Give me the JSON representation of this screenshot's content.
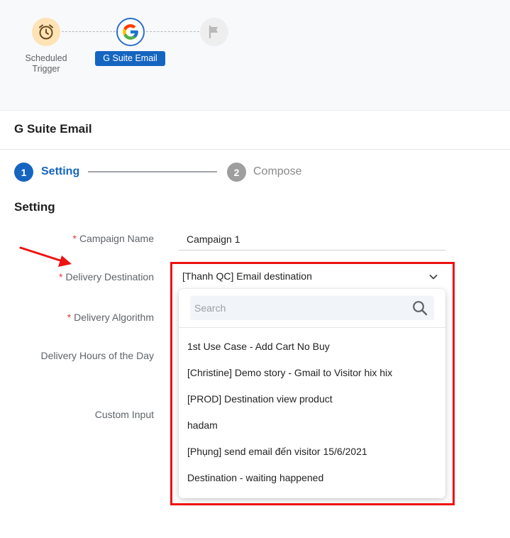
{
  "flow": {
    "nodes": [
      {
        "label": "Scheduled\nTrigger",
        "icon": "alarm-clock-icon"
      },
      {
        "label": "G Suite Email",
        "icon": "google-g-icon"
      },
      {
        "label": "",
        "icon": "flag-icon"
      }
    ]
  },
  "panel": {
    "title": "G Suite Email"
  },
  "stepper": {
    "steps": [
      {
        "number": "1",
        "label": "Setting"
      },
      {
        "number": "2",
        "label": "Compose"
      }
    ]
  },
  "section": {
    "title": "Setting"
  },
  "form": {
    "campaign_name": {
      "label": "Campaign Name",
      "value": "Campaign 1",
      "required": "*"
    },
    "delivery_destination": {
      "label": "Delivery Destination",
      "value": "[Thanh QC] Email destination",
      "required": "*"
    },
    "delivery_algorithm": {
      "label": "Delivery Algorithm",
      "required": "*"
    },
    "delivery_hours": {
      "label": "Delivery Hours of the Day"
    },
    "custom_input": {
      "label": "Custom Input"
    }
  },
  "dropdown": {
    "search_placeholder": "Search",
    "options": [
      "1st Use Case - Add Cart No Buy",
      "[Christine] Demo story - Gmail to Visitor hix hix",
      "[PROD] Destination view product",
      "hadam",
      "[Phụng] send email đến visitor 15/6/2021",
      "Destination - waiting happened"
    ]
  },
  "colors": {
    "primary": "#1565c0",
    "required": "#e53935",
    "annotation": "#ee1111",
    "inactive_step": "#9e9e9e"
  }
}
